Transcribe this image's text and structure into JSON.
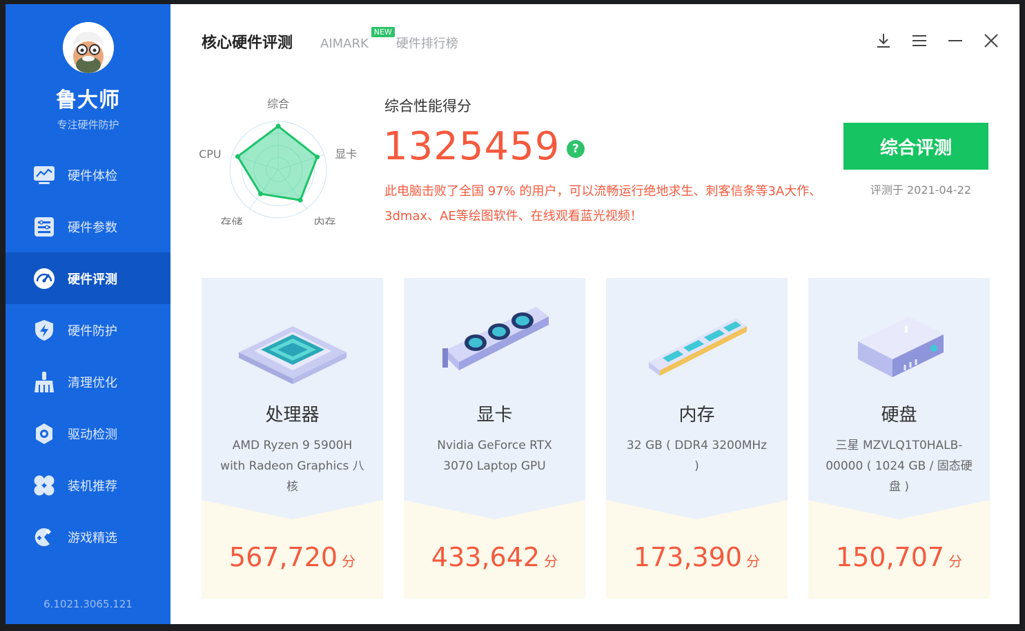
{
  "app": {
    "brand": "鲁大师",
    "slogan": "专注硬件防护",
    "version": "6.1021.3065.121"
  },
  "sidebar": {
    "items": [
      {
        "label": "硬件体检",
        "icon": "monitor-chart-icon",
        "active": false
      },
      {
        "label": "硬件参数",
        "icon": "list-icon",
        "active": false
      },
      {
        "label": "硬件评测",
        "icon": "speedometer-icon",
        "active": true
      },
      {
        "label": "硬件防护",
        "icon": "shield-bolt-icon",
        "active": false
      },
      {
        "label": "清理优化",
        "icon": "broom-icon",
        "active": false
      },
      {
        "label": "驱动检测",
        "icon": "gear-icon",
        "active": false
      },
      {
        "label": "装机推荐",
        "icon": "grid-icon",
        "active": false
      },
      {
        "label": "游戏精选",
        "icon": "gamepad-icon",
        "active": false
      }
    ]
  },
  "tabs": [
    {
      "label": "核心硬件评测",
      "active": true
    },
    {
      "label": "AIMARK",
      "badge": "NEW",
      "active": false
    },
    {
      "label": "硬件排行榜",
      "active": false
    }
  ],
  "radar": {
    "labels": [
      "综合",
      "显卡",
      "内存",
      "存储",
      "CPU"
    ],
    "values": [
      0.9,
      0.85,
      0.78,
      0.62,
      0.88
    ]
  },
  "score": {
    "title": "综合性能得分",
    "value": "1325459",
    "help": "?",
    "description": "此电脑击败了全国 97% 的用户，可以流畅运行绝地求生、刺客信条等3A大作、3dmax、AE等绘图软件、在线观看蓝光视频！",
    "button_label": "综合评测",
    "date": "评测于 2021-04-22"
  },
  "cards": [
    {
      "name": "处理器",
      "icon": "cpu-chip-icon",
      "spec": "AMD Ryzen 9 5900H with Radeon Graphics 八核",
      "score": "567,720",
      "unit": "分"
    },
    {
      "name": "显卡",
      "icon": "graphics-card-icon",
      "spec": "Nvidia GeForce RTX 3070 Laptop GPU",
      "score": "433,642",
      "unit": "分"
    },
    {
      "name": "内存",
      "icon": "memory-stick-icon",
      "spec": "32 GB ( DDR4 3200MHz )",
      "score": "173,390",
      "unit": "分"
    },
    {
      "name": "硬盘",
      "icon": "hard-drive-icon",
      "spec": "三星 MZVLQ1T0HALB-00000 ( 1024 GB / 固态硬盘 )",
      "score": "150,707",
      "unit": "分"
    }
  ],
  "colors": {
    "sidebar": "#1767e0",
    "sidebar_active": "#0f55c4",
    "accent_green": "#16c462",
    "score_red": "#f45a3e"
  }
}
